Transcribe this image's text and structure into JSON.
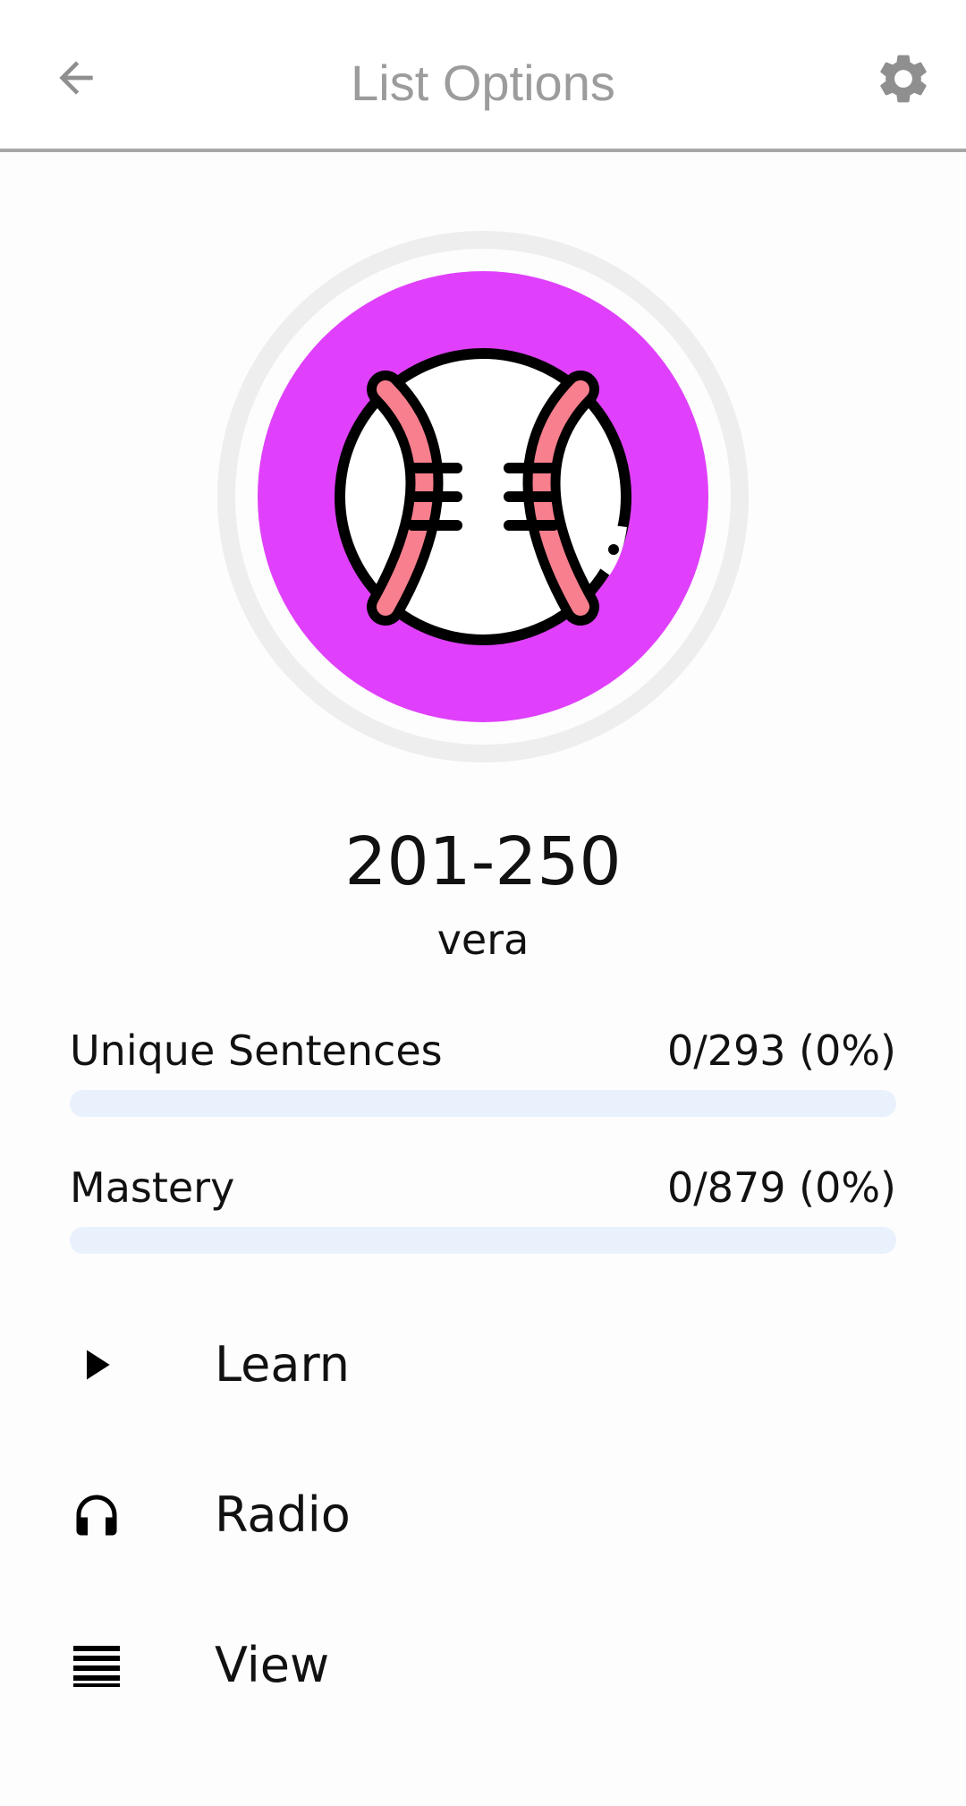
{
  "appbar": {
    "title": "List Options",
    "back_icon": "arrow-left-icon",
    "settings_icon": "gear-icon"
  },
  "hero": {
    "icon": "baseball-icon",
    "ring_color": "#eeeeee",
    "circle_color": "#e040fb",
    "stitch_color": "#f77f8e"
  },
  "list": {
    "name": "201-250",
    "language": "vera"
  },
  "stats": {
    "unique_sentences": {
      "label": "Unique Sentences",
      "value": "0/293 (0%)",
      "progress": 0
    },
    "mastery": {
      "label": "Mastery",
      "value": "0/879 (0%)",
      "progress": 0
    }
  },
  "menu": {
    "learn": {
      "label": "Learn",
      "icon": "play-icon"
    },
    "radio": {
      "label": "Radio",
      "icon": "headphones-icon"
    },
    "view": {
      "label": "View",
      "icon": "list-lines-icon"
    }
  },
  "colors": {
    "title_gray": "#9c9c9c",
    "bar_track": "#e8f1fc"
  }
}
